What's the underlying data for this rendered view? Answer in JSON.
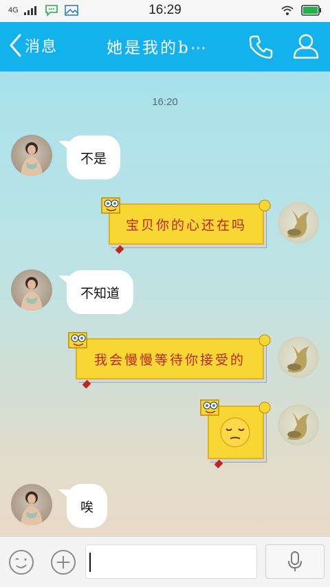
{
  "status_bar": {
    "network": "4G",
    "time": "16:29"
  },
  "header": {
    "back_label": "消息",
    "title": "她是我的b⋯",
    "icons": [
      "back-chevron-icon",
      "phone-icon",
      "profile-icon"
    ]
  },
  "chat": {
    "timestamp": "16:20",
    "messages": [
      {
        "side": "incoming",
        "type": "text",
        "text": "不是"
      },
      {
        "side": "outgoing",
        "type": "sign-sticker",
        "text": "宝贝你的心还在吗"
      },
      {
        "side": "incoming",
        "type": "text",
        "text": "不知道"
      },
      {
        "side": "outgoing",
        "type": "sign-sticker",
        "text": "我会慢慢等待你接受的"
      },
      {
        "side": "outgoing",
        "type": "sign-sticker",
        "text": "",
        "emoji": "pensive-face-icon"
      },
      {
        "side": "incoming",
        "type": "text",
        "text": "唉"
      }
    ]
  },
  "input_bar": {
    "value": "",
    "icons": [
      "emoji-icon",
      "plus-icon",
      "microphone-icon"
    ]
  },
  "colors": {
    "header_bg": "#13b2ec",
    "sign_yellow": "#f7d733",
    "sign_text": "#c0251a"
  }
}
